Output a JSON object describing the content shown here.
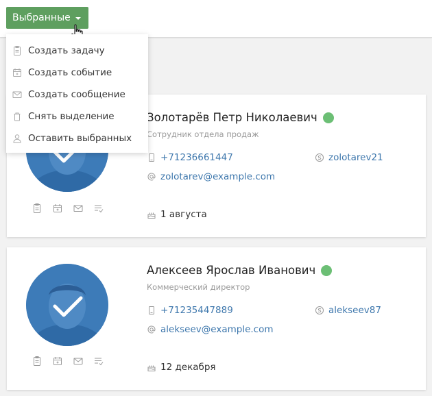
{
  "toolbar": {
    "selected_label": "Выбранные"
  },
  "dropdown": {
    "items": [
      {
        "label": "Создать задачу"
      },
      {
        "label": "Создать событие"
      },
      {
        "label": "Создать сообщение"
      },
      {
        "label": "Снять выделение"
      },
      {
        "label": "Оставить выбранных"
      }
    ]
  },
  "contacts": [
    {
      "name": "Золотарёв Петр Николаевич",
      "position": "Сотрудник отдела продаж",
      "phone": "+71236661447",
      "skype": "zolotarev21",
      "email": "zolotarev@example.com",
      "birthday": "1 августа",
      "online": true
    },
    {
      "name": "Алексеев Ярослав Иванович",
      "position": "Коммерческий директор",
      "phone": "+71235447889",
      "skype": "alekseev87",
      "email": "alekseev@example.com",
      "birthday": "12 декабря",
      "online": true
    }
  ],
  "colors": {
    "accent_green": "#5e9f5f",
    "status_online": "#6cbf75",
    "link_blue": "#3f78ad",
    "avatar_blue": "#3d7bb8"
  },
  "icons": {
    "menu": [
      "clipboard-icon",
      "calendar-add-icon",
      "envelope-icon",
      "trash-icon",
      "user-icon"
    ],
    "card_actions": [
      "task-icon",
      "event-icon",
      "message-icon",
      "list-check-icon"
    ]
  }
}
